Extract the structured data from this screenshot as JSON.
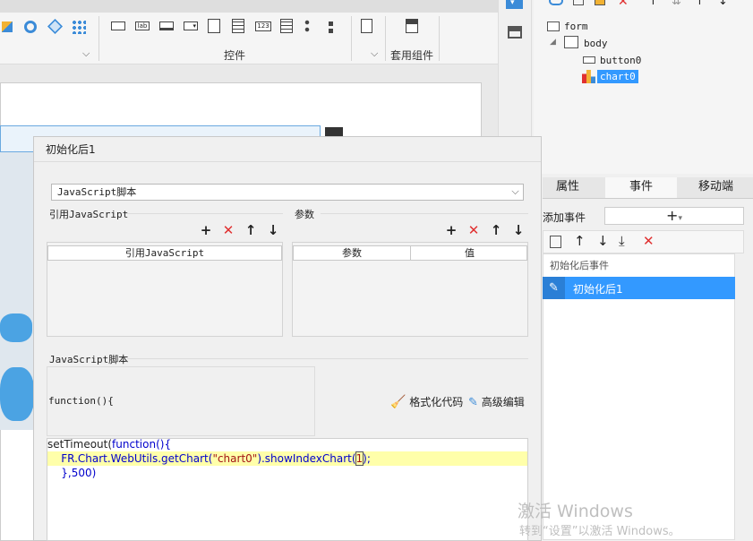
{
  "toolbar": {
    "group_controls_label": "控件",
    "group_components_label": "套用组件",
    "icon_123_label": "123",
    "icon_lab_label": "lab"
  },
  "tree": {
    "form": "form",
    "body": "body",
    "button0": "button0",
    "chart0": "chart0"
  },
  "right_tabs": [
    "属性",
    "事件",
    "移动端"
  ],
  "events": {
    "add_event_label": "添加事件",
    "list_header": "初始化后事件",
    "selected_item": "初始化后1"
  },
  "dialog": {
    "title": "初始化后1",
    "language_select": "JavaScript脚本",
    "ref_js_section": "引用JavaScript",
    "params_section": "参数",
    "ref_js_column": "引用JavaScript",
    "params_column": "参数",
    "value_column": "值",
    "script_section": "JavaScript脚本",
    "function_signature": "function(){",
    "format_code_btn": "格式化代码",
    "advanced_edit_btn": "高级编辑"
  },
  "code": {
    "line1_a": "setTimeout(",
    "line1_b": "function",
    "line1_c": "(){",
    "line2_a": "    FR.Chart.WebUtils.getChart(",
    "line2_b": "\"chart0\"",
    "line2_c": ").showIndexChart(",
    "line2_d": "1",
    "line2_e": ");",
    "line3": "    },500)"
  },
  "watermark": {
    "line1": "激活 Windows",
    "line2": "转到“设置”以激活 Windows。"
  },
  "colors": {
    "accent": "#3399ff",
    "delete_red": "#e03030",
    "highlight": "#ffffaa"
  }
}
